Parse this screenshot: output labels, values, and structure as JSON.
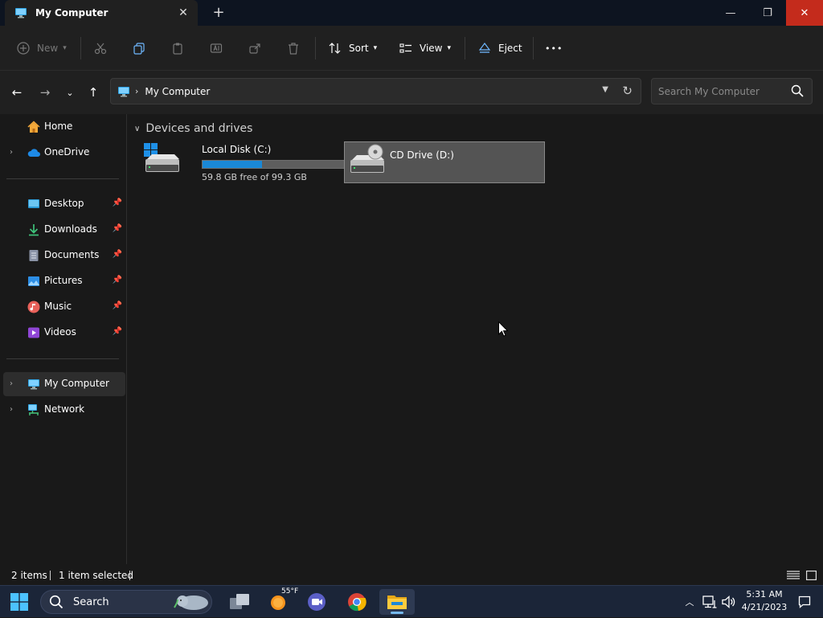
{
  "window": {
    "tab_title": "My Computer",
    "controls": {
      "minimize": "—",
      "restore": "❐",
      "close": "✕"
    }
  },
  "commandbar": {
    "new_label": "New",
    "sort_label": "Sort",
    "view_label": "View",
    "eject_label": "Eject",
    "more_label": "•••"
  },
  "address": {
    "crumb": "My Computer",
    "search_placeholder": "Search My Computer"
  },
  "sidebar": {
    "items": [
      {
        "label": "Home",
        "icon": "home-icon"
      },
      {
        "label": "OneDrive",
        "icon": "cloud-icon"
      },
      {
        "label": "Desktop",
        "icon": "desktop-icon"
      },
      {
        "label": "Downloads",
        "icon": "download-icon"
      },
      {
        "label": "Documents",
        "icon": "document-icon"
      },
      {
        "label": "Pictures",
        "icon": "picture-icon"
      },
      {
        "label": "Music",
        "icon": "music-icon"
      },
      {
        "label": "Videos",
        "icon": "video-icon"
      },
      {
        "label": "My Computer",
        "icon": "computer-icon"
      },
      {
        "label": "Network",
        "icon": "network-icon"
      }
    ]
  },
  "content": {
    "group_title": "Devices and drives",
    "drives": [
      {
        "name": "Local Disk (C:)",
        "free_text": "59.8 GB free of 99.3 GB",
        "used_fraction": 0.398
      },
      {
        "name": "CD Drive (D:)"
      }
    ]
  },
  "status": {
    "items_count": "2 items",
    "selected": "1 item selected"
  },
  "taskbar": {
    "search_label": "Search",
    "weather_temp": "55°F",
    "time": "5:31 AM",
    "date": "4/21/2023"
  },
  "colors": {
    "accent": "#1a88d6",
    "close_button": "#c42b1c",
    "selection": "#545454"
  }
}
